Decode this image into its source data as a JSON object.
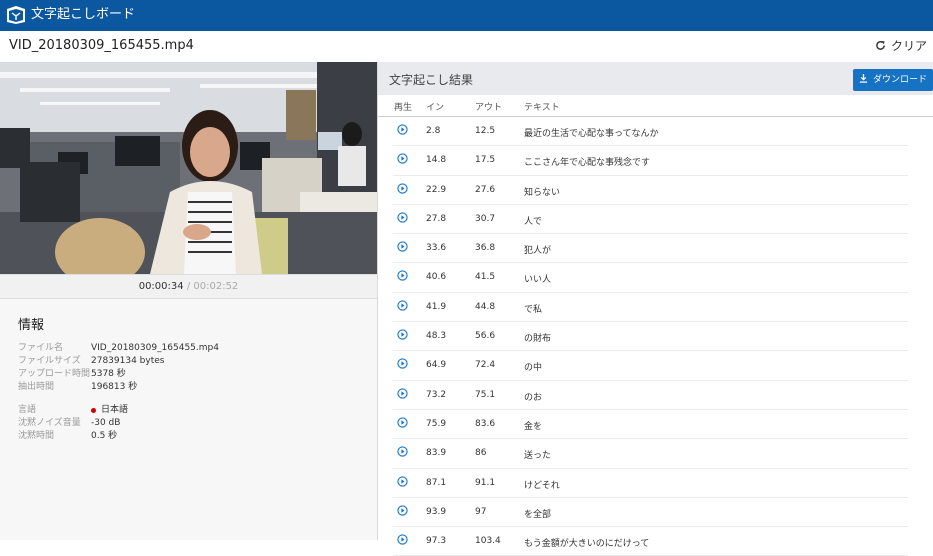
{
  "app": {
    "title": "文字起こしボード"
  },
  "file": {
    "title": "VID_20180309_165455.mp4",
    "clear_label": "クリア"
  },
  "player": {
    "current_time": "00:00:34",
    "separator": "/",
    "duration": "00:02:52"
  },
  "info": {
    "title": "情報",
    "rows": [
      {
        "key": "ファイル名",
        "value": "VID_20180309_165455.mp4"
      },
      {
        "key": "ファイルサイズ",
        "value": "27839134 bytes"
      },
      {
        "key": "アップロード時間",
        "value": "5378 秒"
      },
      {
        "key": "抽出時間",
        "value": "196813 秒"
      }
    ],
    "rows2": [
      {
        "key": "言語",
        "value": "日本語"
      },
      {
        "key": "沈黙ノイズ音量",
        "value": "-30 dB"
      },
      {
        "key": "沈黙時間",
        "value": "0.5 秒"
      }
    ]
  },
  "results": {
    "title": "文字起こし結果",
    "download_label": "ダウンロード",
    "columns": {
      "play": "再生",
      "in": "イン",
      "out": "アウト",
      "text": "テキスト"
    },
    "rows": [
      {
        "in": "2.8",
        "out": "12.5",
        "text": "最近の生活で心配な事ってなんか"
      },
      {
        "in": "14.8",
        "out": "17.5",
        "text": "ここさん年で心配な事残念です"
      },
      {
        "in": "22.9",
        "out": "27.6",
        "text": "知らない"
      },
      {
        "in": "27.8",
        "out": "30.7",
        "text": "人で"
      },
      {
        "in": "33.6",
        "out": "36.8",
        "text": "犯人が"
      },
      {
        "in": "40.6",
        "out": "41.5",
        "text": "いい人"
      },
      {
        "in": "41.9",
        "out": "44.8",
        "text": "で私"
      },
      {
        "in": "48.3",
        "out": "56.6",
        "text": "の財布"
      },
      {
        "in": "64.9",
        "out": "72.4",
        "text": "の中"
      },
      {
        "in": "73.2",
        "out": "75.1",
        "text": "のお"
      },
      {
        "in": "75.9",
        "out": "83.6",
        "text": "金を"
      },
      {
        "in": "83.9",
        "out": "86",
        "text": "送った"
      },
      {
        "in": "87.1",
        "out": "91.1",
        "text": "けどそれ"
      },
      {
        "in": "93.9",
        "out": "97",
        "text": "を全部"
      },
      {
        "in": "97.3",
        "out": "103.4",
        "text": "もう金額が大きいのにだけって"
      }
    ]
  },
  "colors": {
    "topbar": "#0b58a1",
    "accent": "#1673c3",
    "record_dot": "#d40000"
  }
}
